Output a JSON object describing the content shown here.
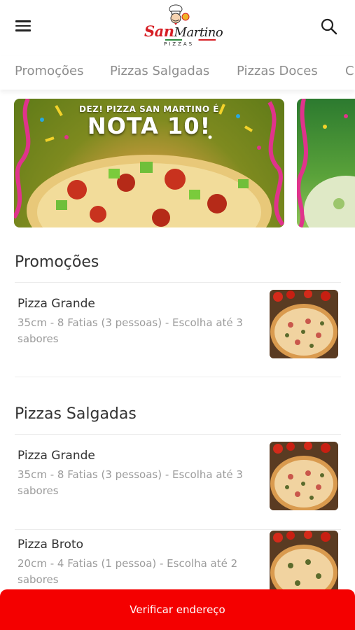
{
  "header": {
    "logo_text_1": "San",
    "logo_text_2": "Martino",
    "logo_sub": "PIZZAS"
  },
  "tabs": [
    "Promoções",
    "Pizzas Salgadas",
    "Pizzas Doces",
    "C"
  ],
  "banners": [
    {
      "tagline": "DEZ! PIZZA SAN MARTINO É",
      "headline": "NOTA 10!"
    }
  ],
  "sections": [
    {
      "title": "Promoções",
      "items": [
        {
          "name": "Pizza Grande",
          "description": "35cm - 8 Fatias (3 pessoas) - Escolha até 3 sabores"
        }
      ]
    },
    {
      "title": "Pizzas Salgadas",
      "items": [
        {
          "name": "Pizza Grande",
          "description": "35cm - 8 Fatias (3 pessoas) - Escolha até 3 sabores"
        },
        {
          "name": "Pizza Broto",
          "description": "20cm - 4 Fatias (1 pessoa) - Escolha até 2 sabores"
        }
      ]
    }
  ],
  "cta": {
    "label": "Verificar endereço"
  },
  "colors": {
    "accent": "#f40000",
    "brand": "#d61e24"
  }
}
